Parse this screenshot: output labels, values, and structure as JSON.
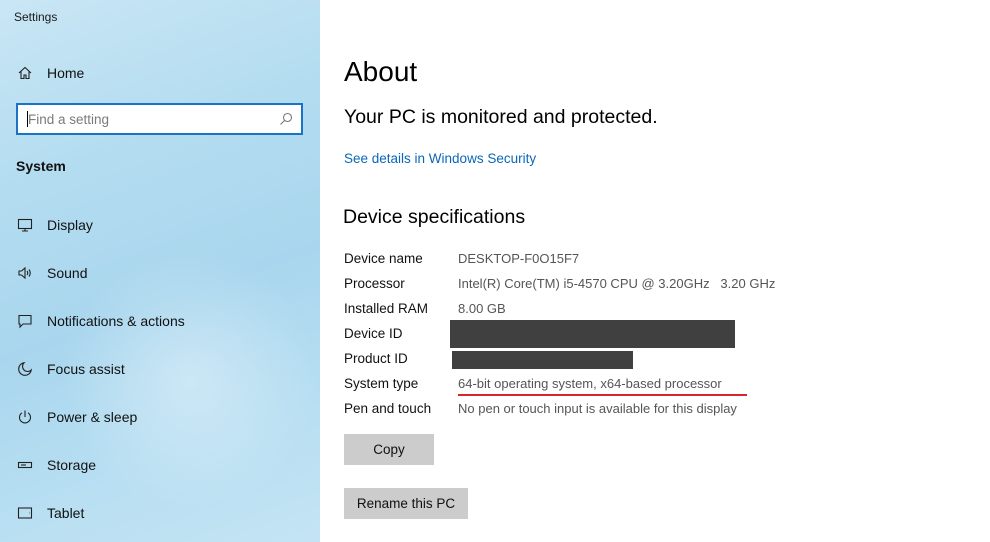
{
  "window": {
    "title": "Settings"
  },
  "sidebar": {
    "home": {
      "label": "Home",
      "icon": "home-icon"
    },
    "search": {
      "placeholder": "Find a setting",
      "value": ""
    },
    "section": "System",
    "items": [
      {
        "label": "Display",
        "icon": "display-icon"
      },
      {
        "label": "Sound",
        "icon": "sound-icon"
      },
      {
        "label": "Notifications & actions",
        "icon": "notifications-icon"
      },
      {
        "label": "Focus assist",
        "icon": "moon-icon"
      },
      {
        "label": "Power & sleep",
        "icon": "power-icon"
      },
      {
        "label": "Storage",
        "icon": "storage-icon"
      },
      {
        "label": "Tablet",
        "icon": "tablet-icon"
      }
    ]
  },
  "main": {
    "title": "About",
    "protection_status": "Your PC is monitored and protected.",
    "security_link": "See details in Windows Security",
    "specs_heading": "Device specifications",
    "specs": [
      {
        "label": "Device name",
        "value": "DESKTOP-F0O15F7"
      },
      {
        "label": "Processor",
        "value": "Intel(R) Core(TM) i5-4570 CPU @ 3.20GHz   3.20 GHz"
      },
      {
        "label": "Installed RAM",
        "value": "8.00 GB"
      },
      {
        "label": "Device ID",
        "value": ""
      },
      {
        "label": "Product ID",
        "value": ""
      },
      {
        "label": "System type",
        "value": "64-bit operating system, x64-based processor"
      },
      {
        "label": "Pen and touch",
        "value": "No pen or touch input is available for this display"
      }
    ],
    "copy_button": "Copy",
    "rename_button": "Rename this PC"
  },
  "colors": {
    "accent": "#0a67b8",
    "search_border": "#1a73c4",
    "redaction": "#404040",
    "underline": "#d9262e"
  }
}
